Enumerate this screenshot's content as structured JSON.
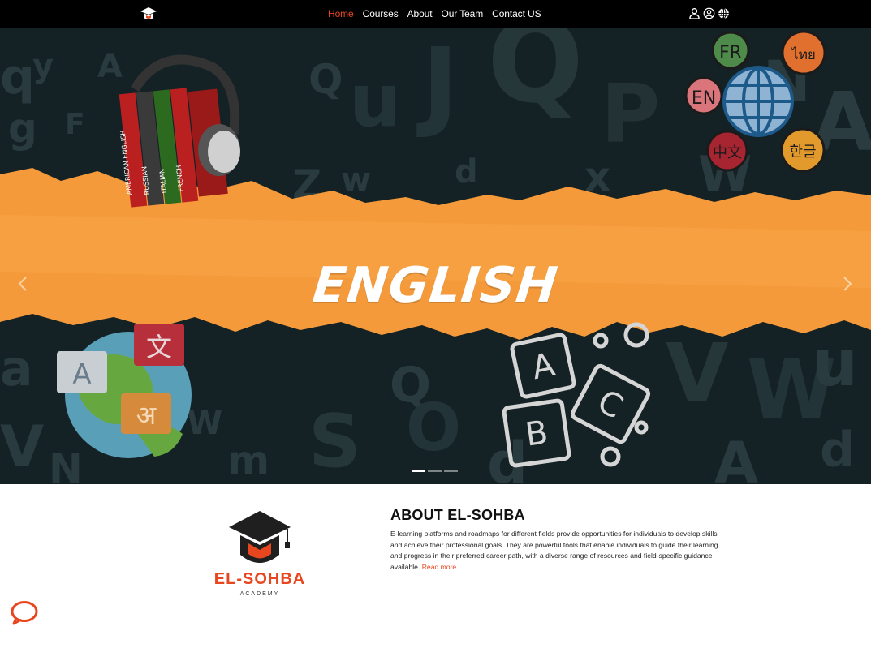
{
  "nav": {
    "links": [
      {
        "label": "Home",
        "active": true
      },
      {
        "label": "Courses",
        "active": false
      },
      {
        "label": "About",
        "active": false
      },
      {
        "label": "Our Team",
        "active": false
      },
      {
        "label": "Contact US",
        "active": false
      }
    ],
    "icons": [
      "user-icon",
      "account-circle-icon",
      "globe-icon"
    ]
  },
  "hero": {
    "title": "ENGLISH",
    "book_spines": [
      "AMERICAN ENGLISH",
      "RUSSIAN",
      "ITALIAN",
      "FRENCH"
    ],
    "bubbles": [
      "FR",
      "EN",
      "ไทย",
      "中文",
      "한글"
    ],
    "globe_bubbles": [
      "A",
      "文",
      "अ"
    ],
    "blocks": [
      "A",
      "B",
      "C"
    ],
    "slides": 3,
    "active_slide": 1
  },
  "about": {
    "title": "ABOUT EL-SOHBA",
    "text": "E-learning platforms and roadmaps for different fields provide opportunities for individuals to develop skills and achieve their professional goals. They are powerful tools that enable individuals to guide their learning and progress in their preferred career path, with a diverse range of resources and field-specific guidance available.",
    "read_more": "Read more....",
    "brand_name": "EL-SOHBA",
    "brand_sub": "ACADEMY"
  },
  "colors": {
    "accent": "#e8461e",
    "navbar": "#000000",
    "hero_bg": "#142125",
    "paper": "#f59a3a"
  }
}
